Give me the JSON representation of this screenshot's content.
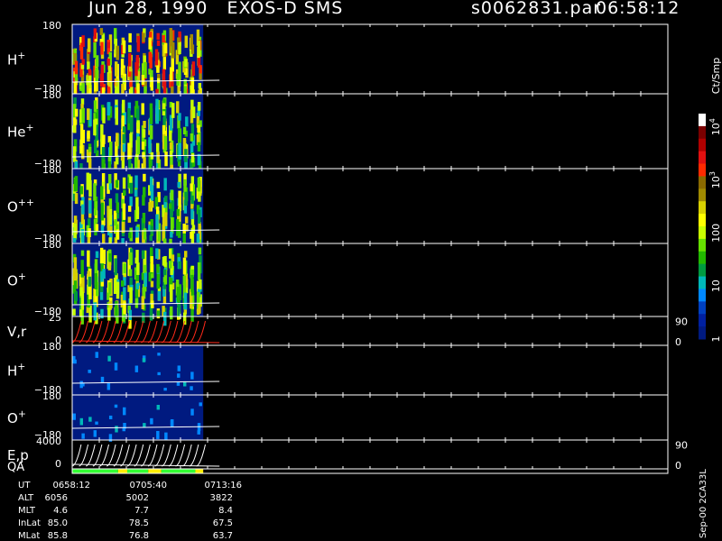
{
  "header": {
    "title": "Jun 28, 1990   EXOS-D SMS",
    "file": "s0062831.par",
    "time": "06:58:12"
  },
  "chart_data": {
    "type": "heatmap",
    "title": "Jun 28, 1990   EXOS-D SMS",
    "panels": [
      {
        "id": "hplus",
        "label": "H",
        "sup": "+",
        "ymax": "180",
        "ymin": "−180",
        "kind": "pitch",
        "filled": true,
        "strength": 1.0
      },
      {
        "id": "heplus",
        "label": "He",
        "sup": "+",
        "ymax": "180",
        "ymin": "−180",
        "kind": "pitch",
        "filled": true,
        "strength": 0.6
      },
      {
        "id": "oplusplus",
        "label": "O",
        "sup": "++",
        "ymax": "180",
        "ymin": "−180",
        "kind": "pitch",
        "filled": true,
        "strength": 0.6
      },
      {
        "id": "oplus",
        "label": "O",
        "sup": "+",
        "ymax": "180",
        "ymin": "−180",
        "kind": "pitch",
        "filled": true,
        "strength": 0.7
      },
      {
        "id": "vr",
        "label": "V,r",
        "sup": "",
        "ymax": "25",
        "ymin": "0",
        "kind": "line",
        "color": "#ff2a1a",
        "right_top": "90",
        "right_bottom": "0"
      },
      {
        "id": "hplus2",
        "label": "H",
        "sup": "+",
        "ymax": "180",
        "ymin": "−180",
        "kind": "pitch",
        "filled": false,
        "strength": 0.2
      },
      {
        "id": "oplus2",
        "label": "O",
        "sup": "+",
        "ymax": "180",
        "ymin": "−180",
        "kind": "pitch",
        "filled": false,
        "strength": 0.2
      },
      {
        "id": "ep",
        "label": "E,p",
        "sup": "",
        "ymax": "4000",
        "ymin": "0",
        "kind": "line",
        "color": "#ffffff",
        "right_top": "90",
        "right_bottom": "0"
      }
    ],
    "qa_label": "QA",
    "qa_segments": [
      {
        "start": 0.0,
        "end": 0.35,
        "color": "#33ff33"
      },
      {
        "start": 0.35,
        "end": 0.42,
        "color": "#ffee00"
      },
      {
        "start": 0.42,
        "end": 0.58,
        "color": "#33ff33"
      },
      {
        "start": 0.58,
        "end": 0.68,
        "color": "#ffee00"
      },
      {
        "start": 0.68,
        "end": 0.94,
        "color": "#33ff33"
      },
      {
        "start": 0.94,
        "end": 1.0,
        "color": "#ffee00"
      }
    ],
    "data_fraction": 0.22,
    "sweep_count": 19,
    "colorbar": {
      "unit": "Ct/Smp",
      "ticks": [
        {
          "label": "10",
          "sup": "4",
          "value": 10000
        },
        {
          "label": "10",
          "sup": "3",
          "value": 1000
        },
        {
          "label": "100",
          "sup": "",
          "value": 100
        },
        {
          "label": "10",
          "sup": "",
          "value": 10
        },
        {
          "label": "1",
          "sup": "",
          "value": 1
        }
      ],
      "colors": [
        "#ffffff",
        "#7a0000",
        "#b00000",
        "#e01010",
        "#ff2a00",
        "#8a6a00",
        "#a08a00",
        "#d8d000",
        "#ffff00",
        "#c8ff00",
        "#66e000",
        "#22b800",
        "#009a40",
        "#00b8b8",
        "#0088ff",
        "#0040c0",
        "#0020a0",
        "#001a80"
      ]
    },
    "info": {
      "rows": [
        {
          "name": "UT",
          "values": [
            "0658:12",
            "0705:40",
            "0713:16"
          ]
        },
        {
          "name": "ALT",
          "values": [
            "6056",
            "5002",
            "3822"
          ]
        },
        {
          "name": "MLT",
          "values": [
            "4.6",
            "7.7",
            "8.4"
          ]
        },
        {
          "name": "InLat",
          "values": [
            "85.0",
            "78.5",
            "67.5"
          ]
        },
        {
          "name": "MLat",
          "values": [
            "85.8",
            "76.8",
            "63.7"
          ]
        }
      ],
      "footer": "Sep-00  2CA33L"
    }
  }
}
